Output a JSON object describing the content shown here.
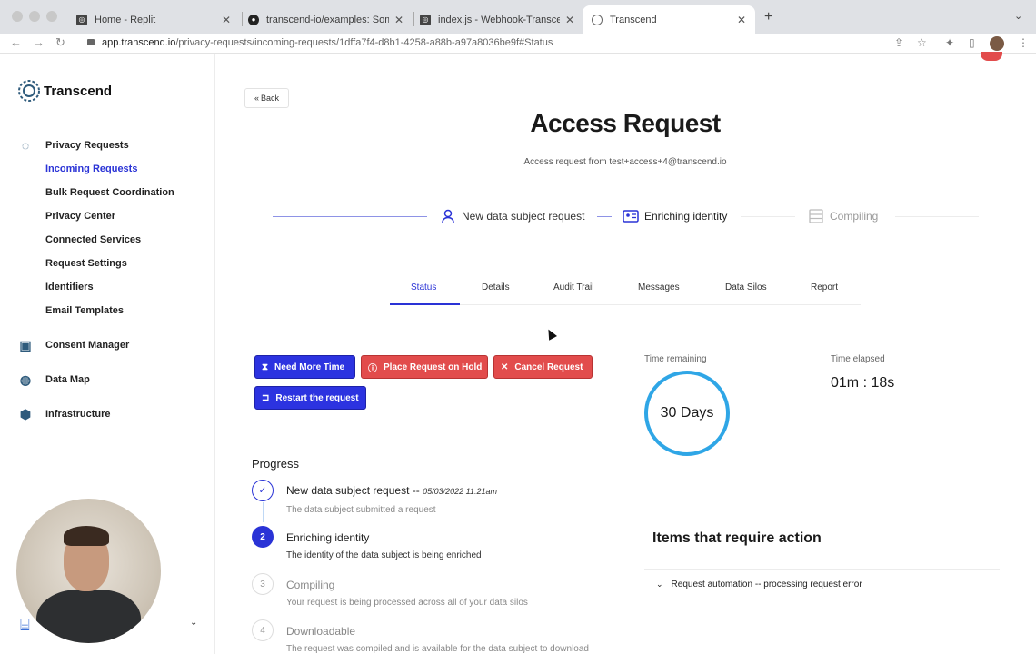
{
  "browser": {
    "tabs": [
      {
        "label": "Home - Replit",
        "icon": "replit-icon"
      },
      {
        "label": "transcend-io/examples: Some",
        "icon": "github-icon"
      },
      {
        "label": "index.js - Webhook-Transcend",
        "icon": "replit-icon"
      },
      {
        "label": "Transcend",
        "icon": "globe-icon"
      }
    ],
    "url_host": "app.transcend.io",
    "url_path": "/privacy-requests/incoming-requests/1dffa7f4-d8b1-4258-a88b-a97a8036be9f#Status"
  },
  "sidebar": {
    "brand": "Transcend",
    "sections": [
      {
        "label": "Privacy Requests",
        "icon": "chat-bubble-icon"
      },
      {
        "label": "Consent Manager",
        "icon": "consent-icon"
      },
      {
        "label": "Data Map",
        "icon": "globe-icon"
      },
      {
        "label": "Infrastructure",
        "icon": "cube-icon"
      }
    ],
    "sub_items": [
      {
        "label": "Incoming Requests"
      },
      {
        "label": "Bulk Request Coordination"
      },
      {
        "label": "Privacy Center"
      },
      {
        "label": "Connected Services"
      },
      {
        "label": "Request Settings"
      },
      {
        "label": "Identifiers"
      },
      {
        "label": "Email Templates"
      }
    ]
  },
  "main": {
    "back_label": "Back",
    "title": "Access Request",
    "subtitle": "Access request from test+access+4@transcend.io",
    "stages": [
      {
        "label": "New data subject request"
      },
      {
        "label": "Enriching identity"
      },
      {
        "label": "Compiling"
      }
    ],
    "tabs": [
      {
        "label": "Status"
      },
      {
        "label": "Details"
      },
      {
        "label": "Audit Trail"
      },
      {
        "label": "Messages"
      },
      {
        "label": "Data Silos"
      },
      {
        "label": "Report"
      }
    ],
    "actions": {
      "more_time": "Need More Time",
      "hold": "Place Request on Hold",
      "cancel": "Cancel Request",
      "restart": "Restart the request"
    },
    "time_remaining_label": "Time remaining",
    "time_remaining_value": "30 Days",
    "time_elapsed_label": "Time elapsed",
    "time_elapsed_value": "01m : 18s",
    "progress": {
      "heading": "Progress",
      "steps": [
        {
          "num": "",
          "title": "New data subject request --",
          "date": "05/03/2022 11:21am",
          "desc": "The data subject submitted a request",
          "state": "done"
        },
        {
          "num": "2",
          "title": "Enriching identity",
          "date": "",
          "desc": "The identity of the data subject is being enriched",
          "state": "active"
        },
        {
          "num": "3",
          "title": "Compiling",
          "date": "",
          "desc": "Your request is being processed across all of your data silos",
          "state": "pending"
        },
        {
          "num": "4",
          "title": "Downloadable",
          "date": "",
          "desc": "The request was compiled and is available for the data subject to download",
          "state": "pending"
        }
      ]
    },
    "items_heading": "Items that require action",
    "items": [
      {
        "label": "Request automation -- processing request error"
      }
    ]
  },
  "colors": {
    "accent": "#2a33d6",
    "danger": "#e24c4c",
    "ring": "#2fa6e6"
  }
}
